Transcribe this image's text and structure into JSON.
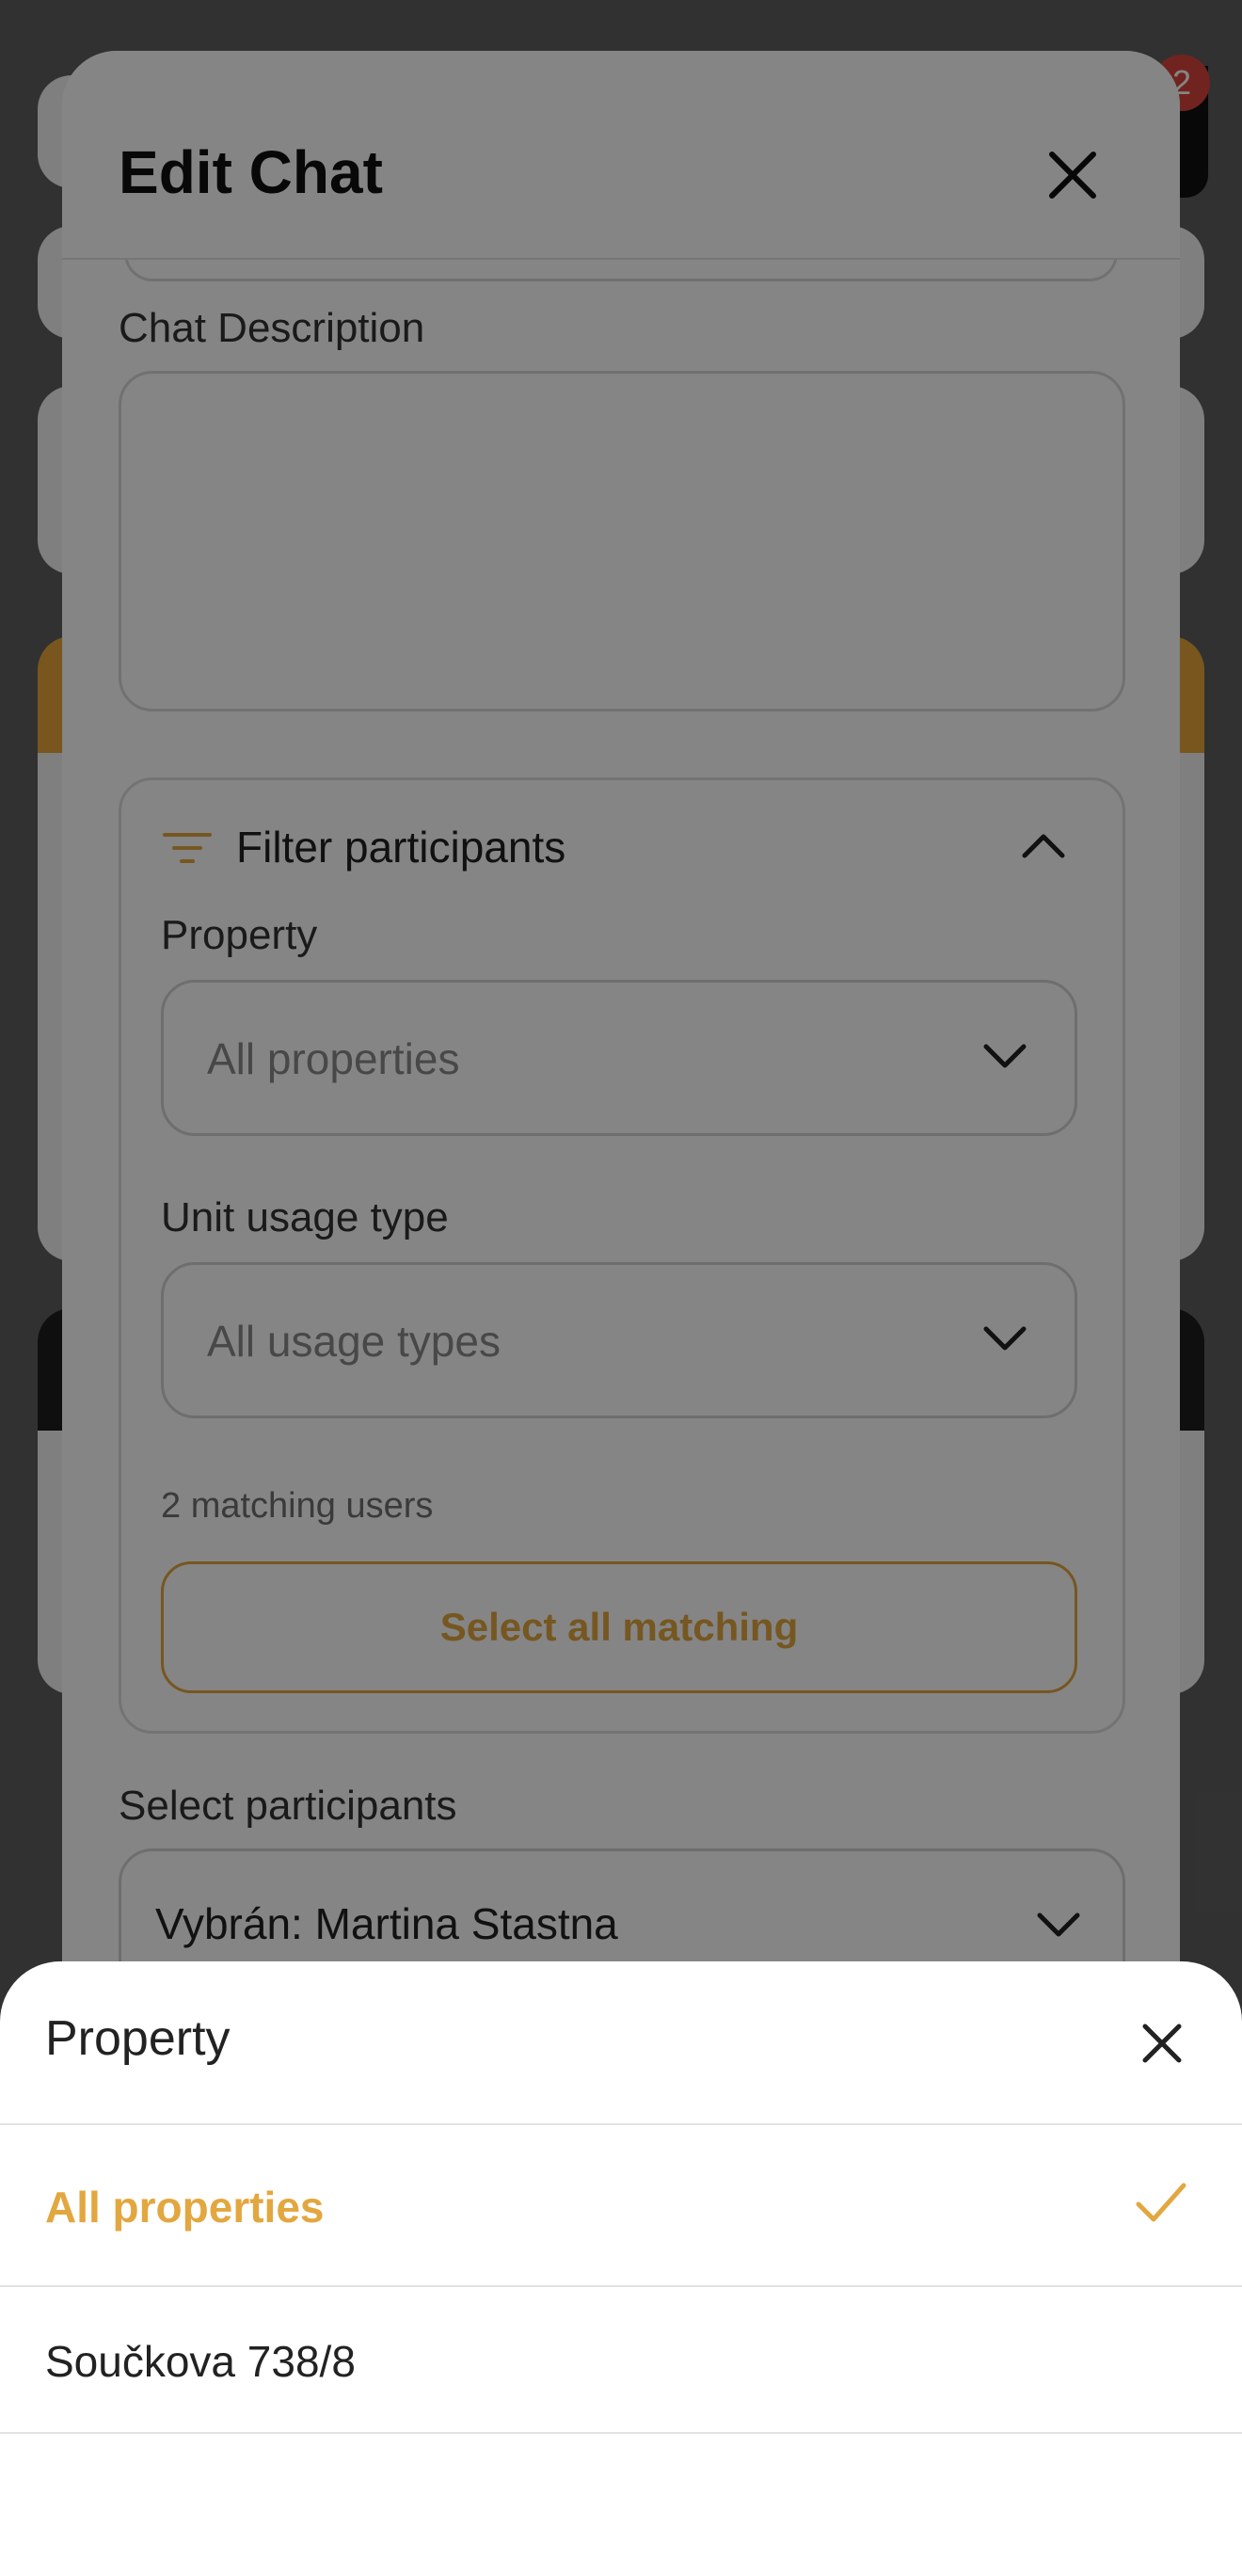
{
  "modal": {
    "title": "Edit Chat",
    "chat_description_label": "Chat Description",
    "chat_description_value": "",
    "filter": {
      "title": "Filter participants",
      "property_label": "Property",
      "property_placeholder": "All properties",
      "usage_label": "Unit usage type",
      "usage_placeholder": "All usage types",
      "matching_count": "2 matching users",
      "select_all_label": "Select all matching"
    },
    "participants_label": "Select participants",
    "participants_value": "Vybrán: Martina Stastna"
  },
  "background": {
    "badge_count": "2"
  },
  "sheet": {
    "title": "Property",
    "options": [
      {
        "label": "All properties",
        "selected": true
      },
      {
        "label": "Součkova 738/8",
        "selected": false
      }
    ]
  },
  "colors": {
    "accent": "#e3a740",
    "dim_overlay": "rgba(0,0,0,0.48)"
  },
  "icons": [
    "close-icon",
    "filter-icon",
    "chevron-up-icon",
    "chevron-down-icon",
    "checkmark-icon"
  ]
}
